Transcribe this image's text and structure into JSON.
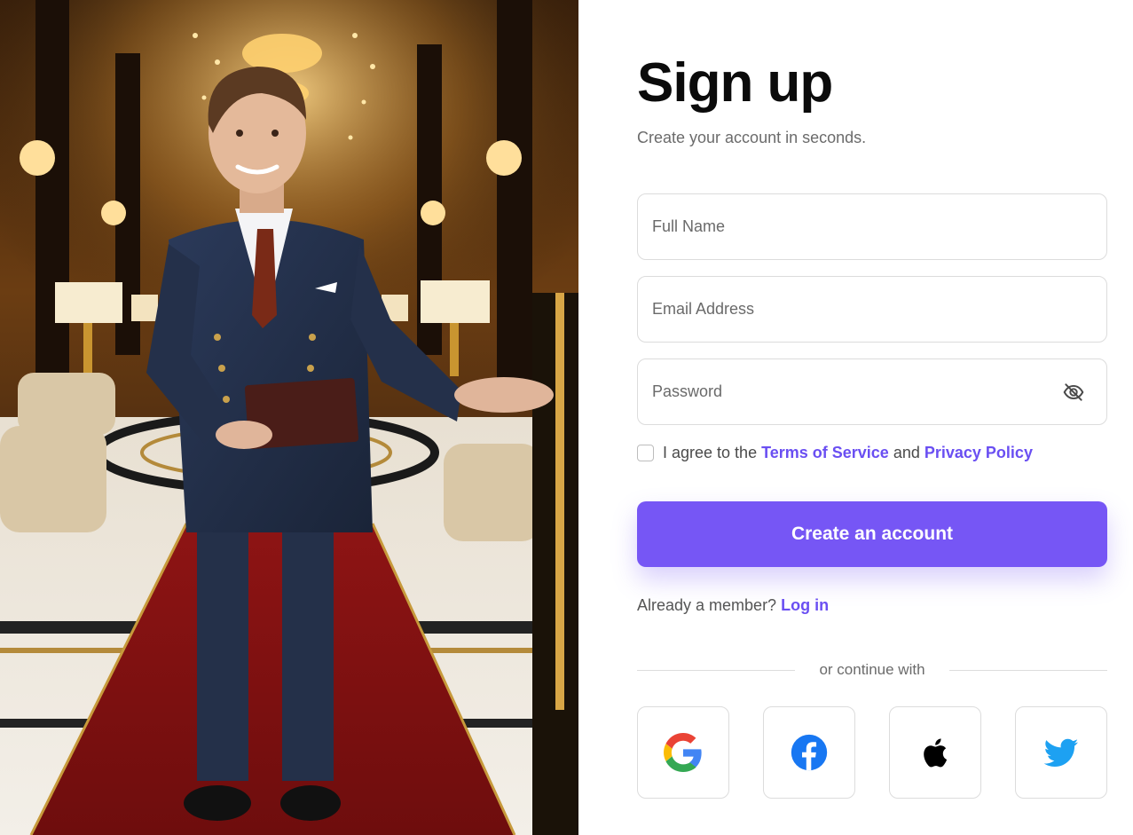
{
  "colors": {
    "accent": "#7656f5",
    "link": "#6a4ff2",
    "border": "#dcdcdc",
    "muted_text": "#6b6b6b",
    "google_blue": "#4285F4",
    "google_red": "#EA4335",
    "google_yellow": "#FBBC05",
    "google_green": "#34A853",
    "facebook_blue": "#1877F2",
    "twitter_blue": "#1DA1F2"
  },
  "hero": {
    "image": "greeter-in-suit-welcoming-in-luxury-hotel-lobby"
  },
  "header": {
    "title": "Sign up",
    "subtitle": "Create your account in seconds."
  },
  "form": {
    "full_name": {
      "placeholder": "Full Name",
      "value": ""
    },
    "email": {
      "placeholder": "Email Address",
      "value": ""
    },
    "password": {
      "placeholder": "Password",
      "value": "",
      "toggle_icon": "eye-off-icon"
    },
    "agree": {
      "checked": false,
      "prefix": "I agree to the ",
      "terms_label": "Terms of Service",
      "middle": " and ",
      "privacy_label": "Privacy Policy"
    },
    "submit_label": "Create an account"
  },
  "login": {
    "prompt": "Already a member? ",
    "link_label": "Log in"
  },
  "divider_text": "or continue with",
  "socials": [
    {
      "name": "google",
      "icon": "google-icon"
    },
    {
      "name": "facebook",
      "icon": "facebook-icon"
    },
    {
      "name": "apple",
      "icon": "apple-icon"
    },
    {
      "name": "twitter",
      "icon": "twitter-icon"
    }
  ]
}
